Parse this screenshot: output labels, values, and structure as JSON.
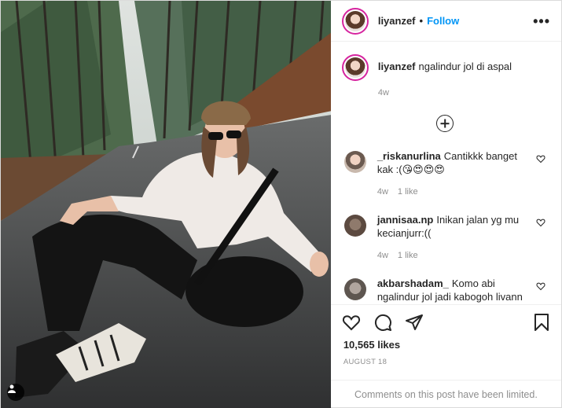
{
  "post": {
    "username": "liyanzef",
    "separator": "•",
    "follow_label": "Follow",
    "more_label": "•••"
  },
  "caption": {
    "username": "liyanzef",
    "text": "ngalindur jol di aspal",
    "time": "4w"
  },
  "comments": [
    {
      "username": "_riskanurlina",
      "text": "Cantikkk banget kak :(😘😍😍😍",
      "time": "4w",
      "likes": "1 like",
      "avatar_color": "#c9b9ad"
    },
    {
      "username": "jannisaa.np",
      "text": "Inikan jalan yg mu kecianjurr:((",
      "time": "4w",
      "likes": "1 like",
      "avatar_color": "#8a7060"
    },
    {
      "username": "akbarshadam_",
      "text": "Komo abi ngalindur jol jadi kabogoh livann",
      "time": "",
      "likes": "",
      "avatar_color": "#9a8f88"
    }
  ],
  "likes_count": "10,565 likes",
  "date": "AUGUST 18",
  "comments_limited": "Comments on this post have been limited.",
  "icons": {
    "like": "heart-icon",
    "comment": "comment-icon",
    "share": "share-icon",
    "save": "bookmark-icon",
    "load_more": "plus-circle-icon",
    "tagged": "user-tag-icon"
  },
  "colors": {
    "link": "#0095f6",
    "muted": "#8e8e8e",
    "text": "#262626",
    "story_ring": "#d6249f"
  }
}
